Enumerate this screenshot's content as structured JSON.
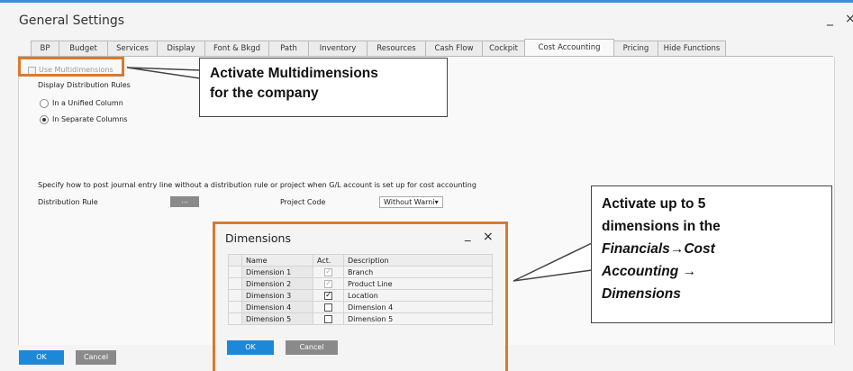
{
  "window": {
    "title": "General Settings",
    "minimize": "_",
    "close": "×"
  },
  "tabs": [
    {
      "label": "BP",
      "active": false
    },
    {
      "label": "Budget",
      "active": false
    },
    {
      "label": "Services",
      "active": false
    },
    {
      "label": "Display",
      "active": false
    },
    {
      "label": "Font & Bkgd",
      "active": false
    },
    {
      "label": "Path",
      "active": false
    },
    {
      "label": "Inventory",
      "active": false
    },
    {
      "label": "Resources",
      "active": false
    },
    {
      "label": "Cash Flow",
      "active": false
    },
    {
      "label": "Cockpit",
      "active": false
    },
    {
      "label": "Cost Accounting",
      "active": true
    },
    {
      "label": "Pricing",
      "active": false
    },
    {
      "label": "Hide Functions",
      "active": false
    }
  ],
  "cost_accounting": {
    "use_multidimensions": "Use Multidimensions",
    "display_rules_label": "Display Distribution Rules",
    "radio_unified": "In a Unified Column",
    "radio_separate": "In Separate Columns",
    "selected_radio": "In Separate Columns",
    "specify_text": "Specify how to post journal entry line without a distribution rule or project when G/L account is set up for cost accounting",
    "distribution_rule_label": "Distribution Rule",
    "distribution_rule_button": "...",
    "project_code_label": "Project Code",
    "project_code_value": "Without Warni"
  },
  "footer": {
    "ok": "OK",
    "cancel": "Cancel"
  },
  "callout_multidim": {
    "line1": "Activate Multidimensions",
    "line2": "for the company"
  },
  "callout_dimensions": {
    "line1": "Activate  up to 5",
    "line2": "dimensions in the",
    "line3a": "Financials",
    "arrow1": "→",
    "line3b": "Cost",
    "line4a": "Accounting ",
    "arrow2": "→",
    "line5": "Dimensions"
  },
  "dimensions_dialog": {
    "title": "Dimensions",
    "minimize": "_",
    "close": "×",
    "columns": [
      "Name",
      "Act.",
      "Description"
    ],
    "rows": [
      {
        "name": "Dimension 1",
        "active": true,
        "locked": true,
        "description": "Branch"
      },
      {
        "name": "Dimension 2",
        "active": true,
        "locked": true,
        "description": "Product Line"
      },
      {
        "name": "Dimension 3",
        "active": true,
        "locked": false,
        "description": "Location"
      },
      {
        "name": "Dimension 4",
        "active": false,
        "locked": false,
        "description": "Dimension 4"
      },
      {
        "name": "Dimension 5",
        "active": false,
        "locked": false,
        "description": "Dimension 5"
      }
    ],
    "ok": "OK",
    "cancel": "Cancel"
  },
  "colors": {
    "highlight_border": "#d9792e",
    "primary_button": "#1e88d8",
    "secondary_button": "#8a8a8a",
    "title_bar_accent": "#3d8ed8"
  }
}
